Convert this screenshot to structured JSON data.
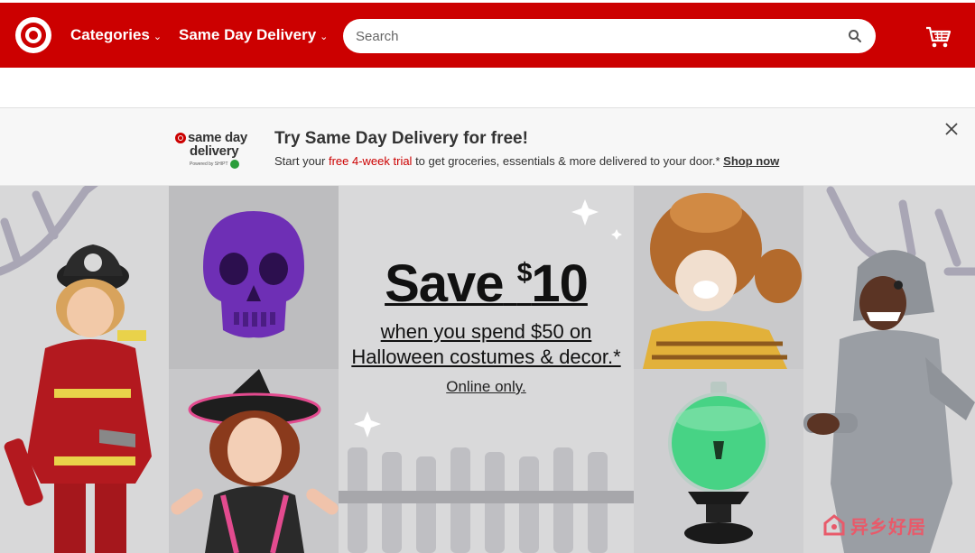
{
  "header": {
    "nav": [
      {
        "label": "Categories"
      },
      {
        "label": "Same Day Delivery"
      }
    ],
    "search": {
      "placeholder": "Search"
    }
  },
  "promo": {
    "logo_line1": "same day",
    "logo_line2": "delivery",
    "logo_line3": "Powered by SHIPT",
    "title": "Try Same Day Delivery for free!",
    "sub_before": "Start your ",
    "sub_trial": "free 4-week trial",
    "sub_after": " to get groceries, essentials & more delivered to your door.*",
    "shop_now": "Shop now"
  },
  "hero": {
    "save_word": "Save",
    "currency": "$",
    "amount": "10",
    "desc": "when you spend $50 on Halloween costumes & decor.*",
    "online": "Online only."
  },
  "watermark": {
    "text": "异乡好居"
  },
  "colors": {
    "brand_red": "#cc0000",
    "watermark": "#e85a6a"
  },
  "icons": [
    "target-logo-icon",
    "chevron-down-icon",
    "search-icon",
    "cart-icon",
    "close-icon",
    "sparkle-icon"
  ]
}
